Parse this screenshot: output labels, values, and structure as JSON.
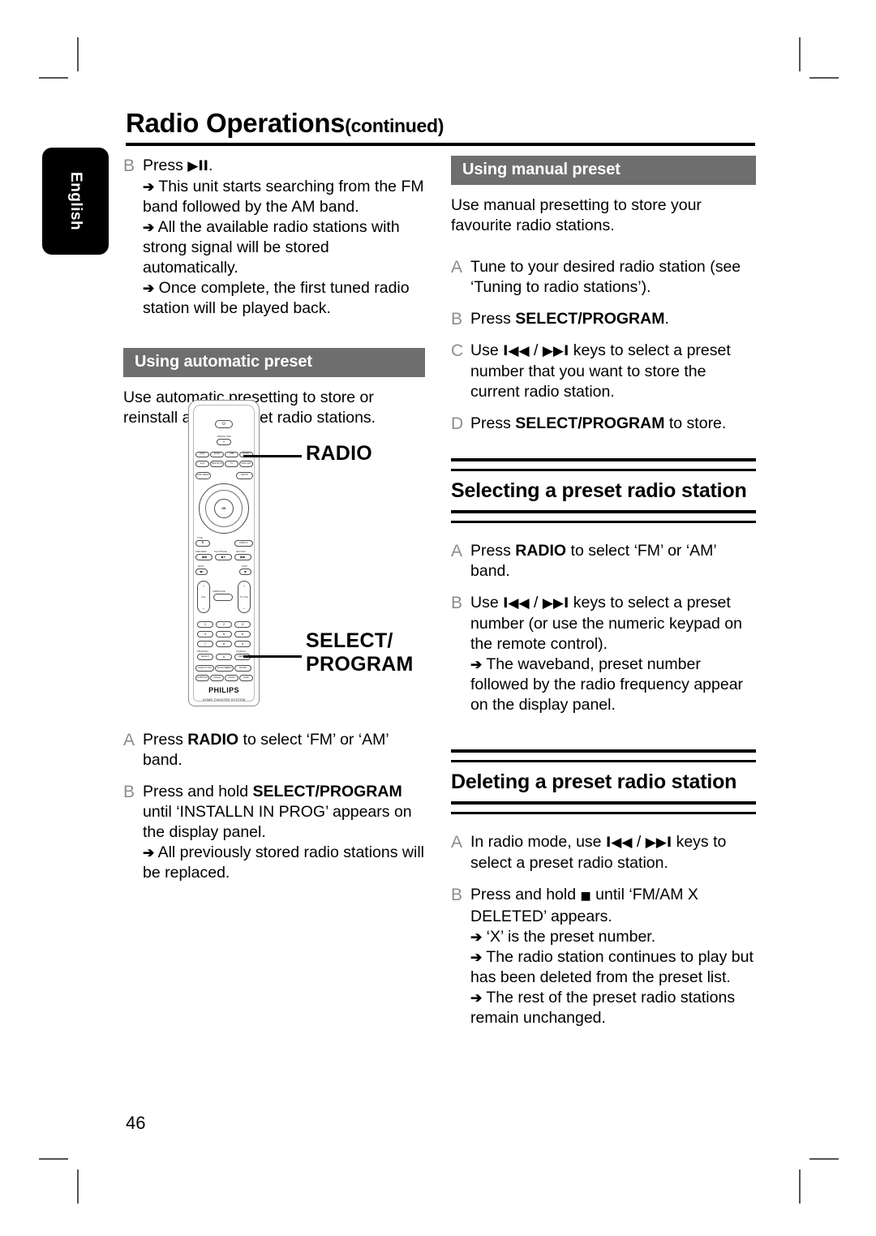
{
  "page": {
    "number": "46",
    "language_tab": "English",
    "title_main": "Radio Operations",
    "title_suffix": "(continued)"
  },
  "left_column": {
    "step_b": {
      "marker": "B",
      "line1_pre": "Press ",
      "line1_glyph": "▶II",
      "line1_post": ".",
      "arrows": [
        "This unit starts searching from the FM band followed by the AM band.",
        "All the available radio stations with strong signal will be stored automatically.",
        "Once complete, the first tuned radio station will be played back."
      ]
    },
    "section_header": "Using automatic preset",
    "section_intro": "Use automatic presetting to store or reinstall all the preset radio stations.",
    "steps": [
      {
        "marker": "A",
        "pre": "Press ",
        "bold": "RADIO",
        "post": " to select ‘FM’ or ‘AM’ band.",
        "arrows": []
      },
      {
        "marker": "B",
        "pre": "Press and hold ",
        "bold": "SELECT/PROGRAM",
        "post": " until ‘INSTALLN IN PROG’ appears on the display panel.",
        "arrows": [
          "All previously stored radio stations will be replaced."
        ]
      }
    ]
  },
  "figure": {
    "callout_radio": "RADIO",
    "callout_select_program": "SELECT/\nPROGRAM",
    "brand": "PHILIPS",
    "brand_sub": "HOME THEATER SYSTEM",
    "remote_buttons": {
      "power": "⏻",
      "open_close_label": "OPEN/CLOSE",
      "open_close": "▲",
      "source_row": [
        "DISC",
        "DOCK",
        "USB",
        "RADIO"
      ],
      "source_row2": [
        "AUX",
        "DIGITAL IN",
        "TV",
        "MP3 LINK"
      ],
      "disc_menu": "DISC MENU",
      "setup": "SETUP",
      "title_label": "TITLE",
      "title_btn": "↰",
      "display": "DISPLAY",
      "transport_labels": [
        "PREV/REW",
        "PLAY/PAUSE",
        "NEXT/FW"
      ],
      "transport": [
        "◀◀",
        "▶II",
        "▶▶"
      ],
      "mute_label": "MUTE",
      "mute": "🔇",
      "stop_label": "STOP",
      "stop": "■",
      "vol_left_mid": "VOL",
      "vol_right_mid": "TV VOL",
      "surround": "AMBISOUND",
      "keypad": [
        "1",
        "2",
        "3",
        "4",
        "5",
        "6",
        "7",
        "8",
        "9"
      ],
      "program_label": "PROGRAM",
      "select_btn": "SELECT",
      "zero": "0",
      "shuffle_label": "SHUFFLE",
      "repeat": "REPEAT",
      "row_audio": [
        "AUDIO SYNC",
        "BASS/TREBLE",
        "SOUND"
      ],
      "row_subtitle": [
        "SUBTITLE",
        "ANGLE",
        "ZOOM",
        "HDMI"
      ]
    }
  },
  "right_column": {
    "section_header": "Using manual preset",
    "section_intro": "Use manual presetting to store your favourite radio stations.",
    "manual_steps": [
      {
        "marker": "A",
        "pre": "Tune to your desired radio station (see ‘Tuning to radio stations’).",
        "bold": "",
        "post": ""
      },
      {
        "marker": "B",
        "pre": "Press ",
        "bold": "SELECT/PROGRAM",
        "post": "."
      },
      {
        "marker": "C",
        "pre": "Use ",
        "glyph1": "I◀◀",
        "sep": " / ",
        "glyph2": "▶▶I",
        "post": " keys to select a preset number that you want to store the current radio station."
      },
      {
        "marker": "D",
        "pre": "Press ",
        "bold": "SELECT/PROGRAM",
        "post": " to store."
      }
    ],
    "heading_select": "Selecting a preset radio station",
    "select_steps": [
      {
        "marker": "A",
        "pre": "Press ",
        "bold": "RADIO",
        "post": " to select ‘FM’ or ‘AM’ band."
      },
      {
        "marker": "B",
        "pre": "Use ",
        "glyph1": "I◀◀",
        "sep": " / ",
        "glyph2": "▶▶I",
        "post": " keys to select a preset number (or use the numeric keypad on the remote control).",
        "arrows": [
          "The waveband, preset number followed by the radio frequency appear on the display panel."
        ]
      }
    ],
    "heading_delete": "Deleting a preset radio station",
    "delete_steps": [
      {
        "marker": "A",
        "pre": "In radio mode, use ",
        "glyph1": "I◀◀",
        "sep": " / ",
        "glyph2": "▶▶I",
        "post": " keys to select a preset radio station."
      },
      {
        "marker": "B",
        "pre": "Press and hold ",
        "glyph1": "■",
        "post": " until ‘FM/AM X DELETED’ appears.",
        "arrows": [
          "‘X’ is the preset number.",
          "The radio station continues to play but has been deleted from the preset list.",
          "The rest of the preset radio stations remain unchanged."
        ]
      }
    ]
  },
  "colors": {
    "section_bar_bg": "#6e6e6e",
    "marker_gray": "#8d8d8d",
    "rule_black": "#000000"
  }
}
